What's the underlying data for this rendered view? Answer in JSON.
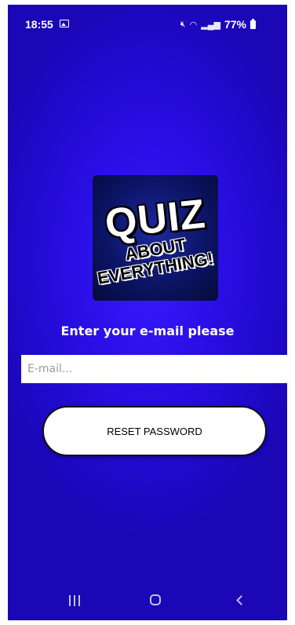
{
  "status_bar": {
    "time": "18:55",
    "battery": "77%",
    "icons": [
      "gallery-icon",
      "mute-icon",
      "wifi-icon",
      "signal-icon",
      "battery-icon"
    ]
  },
  "logo": {
    "line1": "QUIZ",
    "line2": "ABOUT",
    "line3": "EVERYTHING!"
  },
  "form": {
    "prompt": "Enter your e-mail please",
    "email_placeholder": "E-mail...",
    "email_value": "",
    "reset_label": "RESET PASSWORD"
  },
  "nav_bar": {
    "icons": [
      "recents-icon",
      "home-icon",
      "back-icon"
    ]
  },
  "colors": {
    "background": "#2b0fe8",
    "button_bg": "#ffffff",
    "text_light": "#ffffff"
  }
}
